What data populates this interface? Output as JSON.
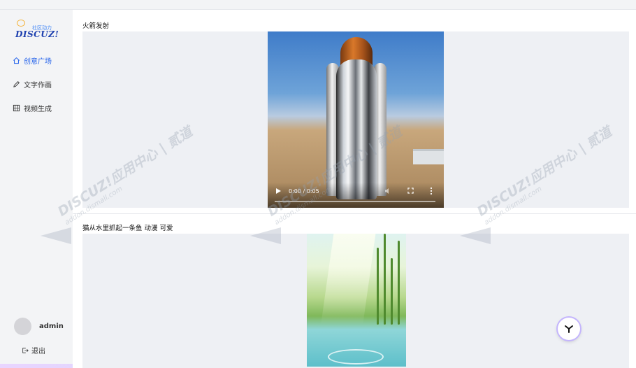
{
  "brand": {
    "tagline": "社区动力",
    "name": "DISCUZ!"
  },
  "sidebar": {
    "items": [
      {
        "label": "创意广场",
        "icon": "home-icon",
        "active": true
      },
      {
        "label": "文字作画",
        "icon": "pen-icon",
        "active": false
      },
      {
        "label": "视频生成",
        "icon": "film-icon",
        "active": false
      }
    ],
    "user": {
      "name": "admin"
    },
    "logout_label": "退出"
  },
  "feed": [
    {
      "title": "火箭发射",
      "type": "video",
      "video": {
        "time": "0:00 / 0:05",
        "progress": 0
      }
    },
    {
      "title": "猫从水里抓起一条鱼 动漫 可爱",
      "type": "image"
    }
  ],
  "colors": {
    "accent": "#2563eb",
    "main_bg": "#ffffff",
    "sidebar_bg": "#f3f4f6",
    "media_bg": "#eef0f4"
  }
}
